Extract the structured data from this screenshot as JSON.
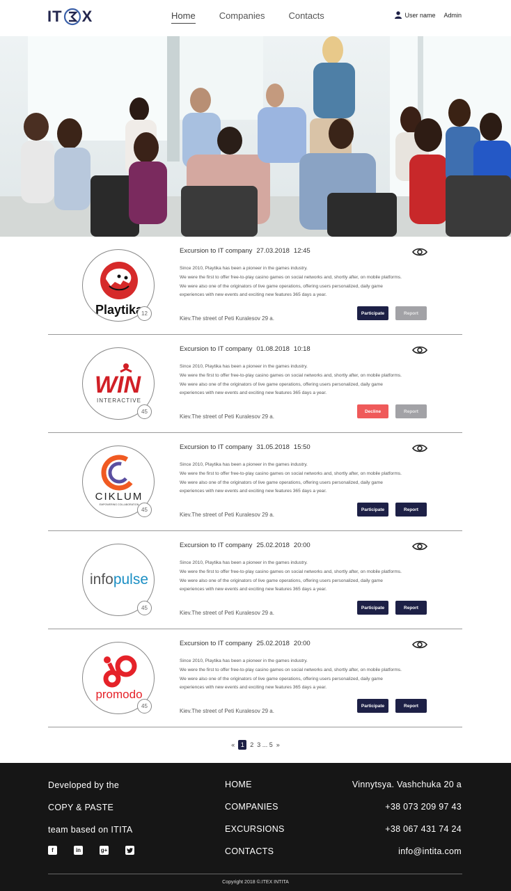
{
  "header": {
    "logo_left": "IT",
    "logo_right": "X",
    "nav": [
      "Home",
      "Companies",
      "Contacts"
    ],
    "user_name": "User name",
    "admin": "Admin"
  },
  "cards": [
    {
      "title": "Excursion to IT company",
      "date": "27.03.2018",
      "time": "12:45",
      "company": "Playtika",
      "count": "12",
      "desc": [
        "Since 2010, Playtika has been a pioneer in the games industry.",
        "We were the first to offer free-to-play casino games on social networks and, shortly after, on mobile platforms.",
        "We were also one of the originators of live game operations, offering users personalized, daily game",
        "experiences with new events and exciting new features 365 days a year."
      ],
      "address": "Kiev.The street of Peti Kuralesov 29 a.",
      "btn1": "Participate",
      "btn2": "Report"
    },
    {
      "title": "Excursion to IT company",
      "date": "01.08.2018",
      "time": "10:18",
      "company": "WIN",
      "company_sub": "INTERACTIVE",
      "count": "45",
      "desc": [
        "Since 2010, Playtika has been a pioneer in the games industry.",
        "We were the first to offer free-to-play casino games on social networks and, shortly after, on mobile platforms.",
        "We were also one of the originators of live game operations, offering users personalized, daily game",
        "experiences with new events and exciting new features 365 days a year."
      ],
      "address": "Kiev.The street of Peti Kuralesov 29 a.",
      "btn1": "Decline",
      "btn2": "Report"
    },
    {
      "title": "Excursion to IT company",
      "date": "31.05.2018",
      "time": "15:50",
      "company": "CIKLUM",
      "company_sub": "EMPOWERING COLLABORATION",
      "count": "45",
      "desc": [
        "Since 2010, Playtika has been a pioneer in the games industry.",
        "We were the first to offer free-to-play casino games on social networks and, shortly after, on mobile platforms.",
        "We were also one of the originators of live game operations, offering users personalized, daily game",
        "experiences with new events and exciting new features 365 days a year."
      ],
      "address": "Kiev.The street of Peti Kuralesov 29 a.",
      "btn1": "Participate",
      "btn2": "Report"
    },
    {
      "title": "Excursion to IT company",
      "date": "25.02.2018",
      "time": "20:00",
      "company_a": "info",
      "company_b": "pulse",
      "count": "45",
      "desc": [
        "Since 2010, Playtika has been a pioneer in the games industry.",
        "We were the first to offer free-to-play casino games on social networks and, shortly after, on mobile platforms.",
        "We were also one of the originators of live game operations, offering users personalized, daily game",
        "experiences with new events and exciting new features 365 days a year."
      ],
      "address": "Kiev.The street of Peti Kuralesov 29 a.",
      "btn1": "Participate",
      "btn2": "Report"
    },
    {
      "title": "Excursion to IT company",
      "date": "25.02.2018",
      "time": "20:00",
      "company": "promodo",
      "count": "45",
      "desc": [
        "Since 2010, Playtika has been a pioneer in the games industry.",
        "We were the first to offer free-to-play casino games on social networks and, shortly after, on mobile platforms.",
        "We were also one of the originators of live game operations, offering users personalized, daily game",
        "experiences with new events and exciting new features 365 days a year."
      ],
      "address": "Kiev.The street of Peti Kuralesov 29 a.",
      "btn1": "Participate",
      "btn2": "Report"
    }
  ],
  "pagination": {
    "prev": "«",
    "current": "1",
    "p2": "2",
    "p3": "3 ... 5",
    "next": "»"
  },
  "footer": {
    "left": [
      "Developed by the",
      "COPY & PASTE",
      "team based on ITITA"
    ],
    "nav": [
      "HOME",
      "COMPANIES",
      "EXCURSIONS",
      "CONTACTS"
    ],
    "contacts": [
      "Vinnytsya. Vashchuka 20 a",
      "+38 073 209 97 43",
      "+38 067 431 74 24",
      "info@intita.com"
    ],
    "socials": [
      "facebook-icon",
      "linkedin-icon",
      "google-plus-icon",
      "twitter-icon"
    ],
    "copyright": "Copyright 2018 ©.ITEX INTITA"
  },
  "colors": {
    "navy": "#1d2046",
    "decline": "#ef5a5a",
    "disabled": "#a2a2a6",
    "footer_bg": "#161616"
  }
}
